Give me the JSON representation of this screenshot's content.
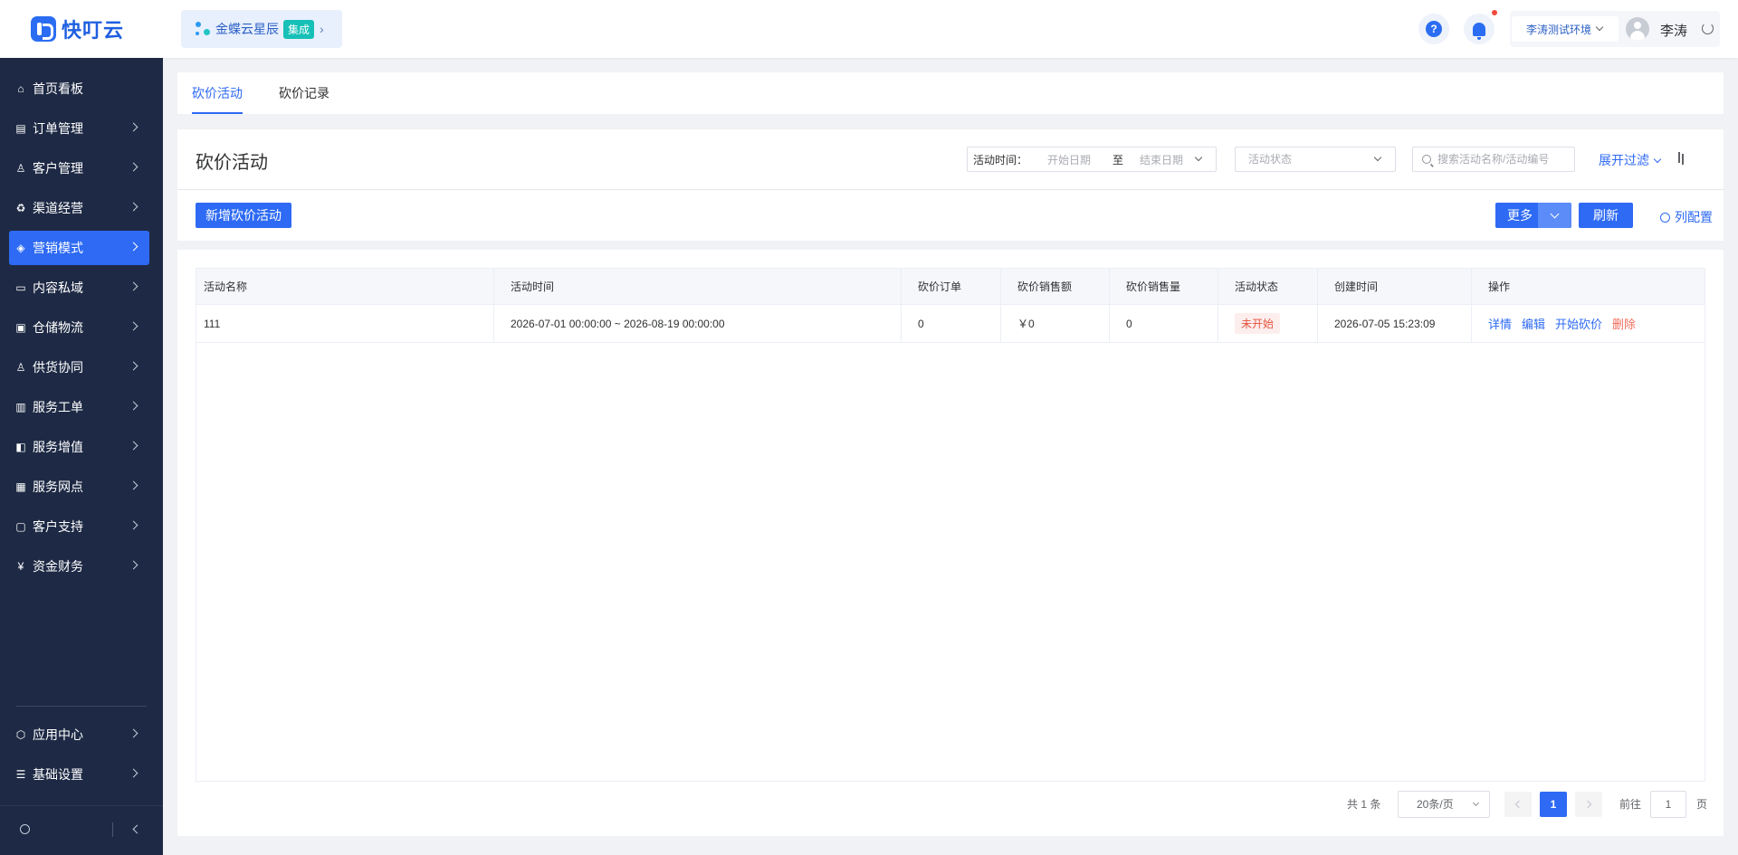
{
  "header": {
    "logo_text": "快叮云",
    "integration": {
      "name": "金蝶云星辰",
      "badge": "集成"
    },
    "environment": "李涛测试环境",
    "user_name": "李涛"
  },
  "sidebar": {
    "items": [
      {
        "label": "首页看板",
        "icon": "home-icon",
        "has_children": false
      },
      {
        "label": "订单管理",
        "icon": "clipboard-icon",
        "has_children": true
      },
      {
        "label": "客户管理",
        "icon": "user-icon",
        "has_children": true
      },
      {
        "label": "渠道经营",
        "icon": "channel-icon",
        "has_children": true
      },
      {
        "label": "营销模式",
        "icon": "tag-icon",
        "has_children": true,
        "active": true
      },
      {
        "label": "内容私域",
        "icon": "image-icon",
        "has_children": true
      },
      {
        "label": "仓储物流",
        "icon": "warehouse-icon",
        "has_children": true
      },
      {
        "label": "供货协同",
        "icon": "supplier-icon",
        "has_children": true
      },
      {
        "label": "服务工单",
        "icon": "ticket-icon",
        "has_children": true
      },
      {
        "label": "服务增值",
        "icon": "bag-icon",
        "has_children": true
      },
      {
        "label": "服务网点",
        "icon": "store-icon",
        "has_children": true
      },
      {
        "label": "客户支持",
        "icon": "support-icon",
        "has_children": true
      },
      {
        "label": "资金财务",
        "icon": "yen-icon",
        "has_children": true
      }
    ],
    "bottom_items": [
      {
        "label": "应用中心",
        "icon": "cube-icon"
      },
      {
        "label": "基础设置",
        "icon": "sliders-icon"
      }
    ]
  },
  "tabs": [
    {
      "label": "砍价活动",
      "active": true
    },
    {
      "label": "砍价记录",
      "active": false
    }
  ],
  "filter": {
    "title": "砍价活动",
    "time_label": "活动时间：",
    "start_placeholder": "开始日期",
    "range_separator": "至",
    "end_placeholder": "结束日期",
    "status_placeholder": "活动状态",
    "search_placeholder": "搜索活动名称/活动编号",
    "expand_label": "展开过滤"
  },
  "toolbar": {
    "add_label": "新增砍价活动",
    "more_label": "更多",
    "refresh_label": "刷新",
    "column_config_label": "列配置"
  },
  "table": {
    "columns": [
      "活动名称",
      "活动时间",
      "砍价订单",
      "砍价销售额",
      "砍价销售量",
      "活动状态",
      "创建时间",
      "操作"
    ],
    "rows": [
      {
        "name": "111",
        "time": "2026-07-01 00:00:00 ~ 2026-08-19 00:00:00",
        "orders": "0",
        "sales_amount": "￥0",
        "sales_volume": "0",
        "status": "未开始",
        "created": "2026-07-05 15:23:09",
        "actions": [
          "详情",
          "编辑",
          "开始砍价",
          "删除"
        ]
      }
    ]
  },
  "pagination": {
    "total_text": "共 1 条",
    "page_size": "20条/页",
    "current_page": "1",
    "goto_label": "前往",
    "goto_value": "1",
    "goto_suffix": "页"
  },
  "colors": {
    "primary": "#2e6af3",
    "sidebar_bg": "#1e2a45",
    "danger": "#f56c5b",
    "badge": "#16c0b7"
  }
}
